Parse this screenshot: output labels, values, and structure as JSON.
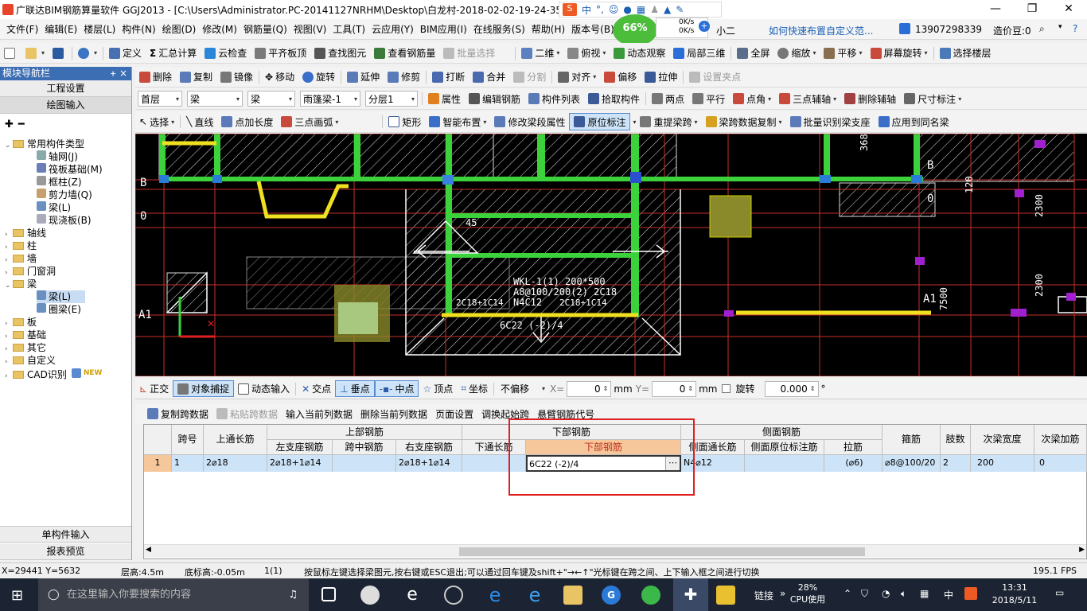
{
  "window": {
    "title": "广联达BIM钢筋算量软件 GGJ2013 - [C:\\Users\\Administrator.PC-20141127NRHM\\Desktop\\白龙村-2018-02-02-19-24-35"
  },
  "menu": [
    "文件(F)",
    "编辑(E)",
    "楼层(L)",
    "构件(N)",
    "绘图(D)",
    "修改(M)",
    "钢筋量(Q)",
    "视图(V)",
    "工具(T)",
    "云应用(Y)",
    "BIM应用(I)",
    "在线服务(S)",
    "帮助(H)",
    "版本号(B)"
  ],
  "menu_right": {
    "tip": "如何快速布置自定义范...",
    "phone": "13907298339",
    "price": "造价豆:0",
    "user": "小二"
  },
  "net": {
    "pct": "66%",
    "up": "0K/s",
    "down": "0K/s"
  },
  "ime": {
    "lang": "中"
  },
  "toolbar1": [
    "定义",
    "汇总计算",
    "云检查",
    "平齐板顶",
    "查找图元",
    "查看钢筋量",
    "批量选择",
    "二维",
    "俯视",
    "动态观察",
    "局部三维",
    "全屏",
    "缩放",
    "平移",
    "屏幕旋转",
    "选择楼层"
  ],
  "panel": {
    "title": "模块导航栏",
    "btn1": "工程设置",
    "btn2": "绘图输入",
    "bottom1": "单构件输入",
    "bottom2": "报表预览"
  },
  "tree": {
    "root": "常用构件类型",
    "common": [
      "轴网(J)",
      "筏板基础(M)",
      "框柱(Z)",
      "剪力墙(Q)",
      "梁(L)",
      "现浇板(B)"
    ],
    "groups": [
      "轴线",
      "柱",
      "墙",
      "门窗洞"
    ],
    "beam": "梁",
    "beam_items": [
      "梁(L)",
      "圈梁(E)"
    ],
    "groups2": [
      "板",
      "基础",
      "其它",
      "自定义",
      "CAD识别"
    ],
    "new": "NEW"
  },
  "toolbar2": [
    "删除",
    "复制",
    "镜像",
    "移动",
    "旋转",
    "延伸",
    "修剪",
    "打断",
    "合并",
    "分割",
    "对齐",
    "偏移",
    "拉伸",
    "设置夹点"
  ],
  "toolbar3": {
    "combos": [
      "首层",
      "梁",
      "梁",
      "雨篷梁-1",
      "分层1"
    ],
    "items": [
      "属性",
      "编辑钢筋",
      "构件列表",
      "拾取构件",
      "两点",
      "平行",
      "点角",
      "三点辅轴",
      "删除辅轴",
      "尺寸标注"
    ]
  },
  "toolbar4": [
    "选择",
    "直线",
    "点加长度",
    "三点画弧",
    "矩形",
    "智能布置",
    "修改梁段属性",
    "原位标注",
    "重提梁跨",
    "梁跨数据复制",
    "批量识别梁支座",
    "应用到同名梁"
  ],
  "cad": {
    "texts": [
      "WKL-1(1) 200*500",
      "A8@100/200(2) 2C18",
      "N4C12",
      "2C18+1C14",
      "2C18+1C14",
      "6C22 (-2)/4",
      "45",
      "B",
      "0",
      "A1",
      "B",
      "0",
      "A1",
      "368",
      "120",
      "2300",
      "7500",
      "2300"
    ]
  },
  "snapbar": {
    "items": [
      "正交",
      "对象捕捉",
      "动态输入",
      "交点",
      "垂点",
      "中点",
      "顶点",
      "坐标"
    ],
    "offset": "不偏移",
    "x_label": "X=",
    "x": "0",
    "y_label": "Y=",
    "y": "0",
    "unit": "mm",
    "rotate": "旋转",
    "rot": "0.000",
    "deg": "°"
  },
  "gridtb": [
    "复制跨数据",
    "粘贴跨数据",
    "输入当前列数据",
    "删除当前列数据",
    "页面设置",
    "调换起始跨",
    "悬臂钢筋代号"
  ],
  "grid": {
    "groups": [
      "上部钢筋",
      "下部钢筋",
      "侧面钢筋"
    ],
    "headers": [
      "跨号",
      "上通长筋",
      "左支座钢筋",
      "跨中钢筋",
      "右支座钢筋",
      "下通长筋",
      "下部钢筋",
      "侧面通长筋",
      "侧面原位标注筋",
      "拉筋",
      "箍筋",
      "肢数",
      "次梁宽度",
      "次梁加筋"
    ],
    "row": [
      "1",
      "1",
      "2⌀18",
      "2⌀18+1⌀14",
      "",
      "2⌀18+1⌀14",
      "",
      "6C22 (-2)/4",
      "N4⌀12",
      "",
      "(⌀6)",
      "⌀8@100/20",
      "2",
      "200",
      "0"
    ]
  },
  "status": {
    "coords": "X=29441 Y=5632",
    "floor_h": "层高:4.5m",
    "base_h": "底标高:-0.05m",
    "sel": "1(1)",
    "hint": "按鼠标左键选择梁图元,按右键或ESC退出;可以通过回车键及shift+\"→←↑\"光标键在跨之间、上下输入框之间进行切换",
    "fps": "195.1 FPS"
  },
  "taskbar": {
    "search": "在这里输入你要搜索的内容",
    "link": "链接",
    "cpu": "28%",
    "cpu_label": "CPU使用",
    "lang": "中",
    "time": "13:31",
    "date": "2018/5/11"
  }
}
